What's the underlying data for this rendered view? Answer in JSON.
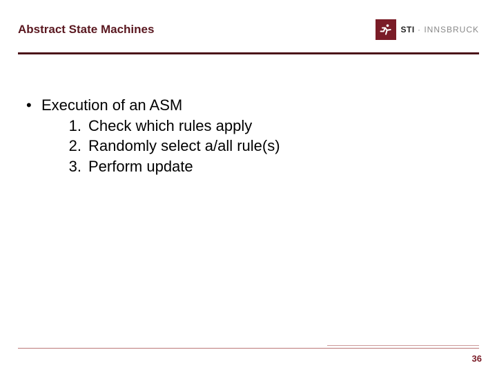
{
  "header": {
    "title": "Abstract State Machines",
    "logo": {
      "bold": "STI",
      "light": " · INNSBRUCK"
    }
  },
  "content": {
    "bullet": "Execution of an ASM",
    "items": [
      {
        "num": "1.",
        "text": "Check which rules apply"
      },
      {
        "num": "2.",
        "text": "Randomly select a/all rule(s)"
      },
      {
        "num": "3.",
        "text": "Perform update"
      }
    ]
  },
  "page_number": "36"
}
